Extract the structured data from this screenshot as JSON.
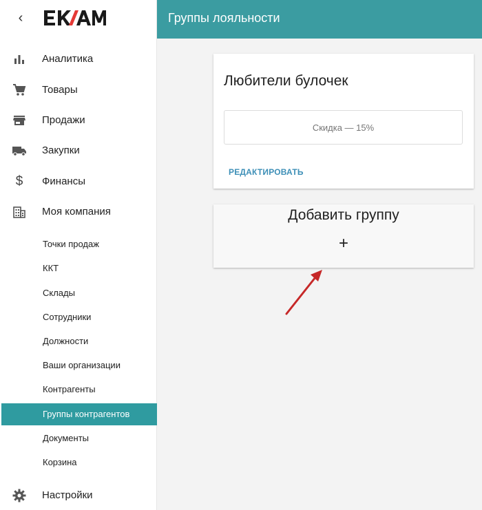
{
  "brand": {
    "back_glyph": "‹",
    "logo_text": "EKAM"
  },
  "sidebar": {
    "items": [
      {
        "label": "Аналитика",
        "icon": "bar-chart-icon"
      },
      {
        "label": "Товары",
        "icon": "cart-icon"
      },
      {
        "label": "Продажи",
        "icon": "store-icon"
      },
      {
        "label": "Закупки",
        "icon": "truck-icon"
      },
      {
        "label": "Финансы",
        "icon": "dollar-icon"
      },
      {
        "label": "Моя компания",
        "icon": "building-icon"
      }
    ],
    "subitems": [
      {
        "label": "Точки продаж"
      },
      {
        "label": "ККТ"
      },
      {
        "label": "Склады"
      },
      {
        "label": "Сотрудники"
      },
      {
        "label": "Должности"
      },
      {
        "label": "Ваши организации"
      },
      {
        "label": "Контрагенты"
      },
      {
        "label": "Группы контрагентов",
        "active": true
      },
      {
        "label": "Документы"
      },
      {
        "label": "Корзина"
      }
    ],
    "settings": {
      "label": "Настройки",
      "icon": "gear-icon"
    }
  },
  "header": {
    "title": "Группы лояльности"
  },
  "main": {
    "group_card": {
      "name": "Любители булочек",
      "discount": "Скидка — 15%",
      "edit_label": "РЕДАКТИРОВАТЬ"
    },
    "add_card": {
      "title": "Добавить группу",
      "plus": "+"
    }
  },
  "colors": {
    "accent": "#3b9ca1",
    "active_item": "#2f9ba0",
    "link": "#3d8fb7",
    "annotation_arrow": "#c62828"
  }
}
